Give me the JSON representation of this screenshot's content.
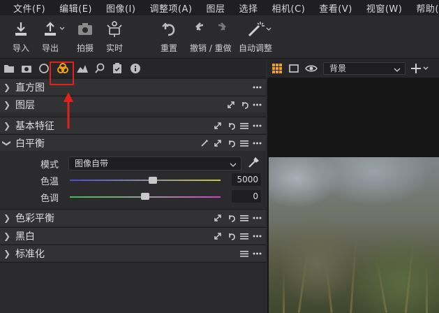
{
  "menu": {
    "items": [
      "文件(F)",
      "编辑(E)",
      "图像(I)",
      "调整项(A)",
      "图层",
      "选择",
      "相机(C)",
      "查看(V)",
      "视窗(W)",
      "帮助(H)"
    ]
  },
  "toolbar": {
    "import": "导入",
    "export": "导出",
    "capture": "拍摄",
    "live": "实时",
    "reset": "重置",
    "undo_redo": "撤销 / 重做",
    "auto_adjust": "自动调整"
  },
  "panel_tabs": [
    "library-icon",
    "camera-icon",
    "lens-icon",
    "color-icon",
    "exposure-icon",
    "details-icon",
    "adjustments-icon",
    "metadata-icon"
  ],
  "sections": {
    "histogram": "直方图",
    "layers": "图层",
    "basic": "基本特征",
    "white_balance": "白平衡",
    "color_balance": "色彩平衡",
    "black_white": "黑白",
    "normalize": "标准化"
  },
  "white_balance": {
    "mode_label": "模式",
    "mode_value": "图像自带",
    "kelvin_label": "色温",
    "kelvin_value": "5000",
    "kelvin_level": 0.55,
    "tint_label": "色调",
    "tint_value": "0",
    "tint_level": 0.5
  },
  "viewer": {
    "background_select": "背景"
  },
  "colors": {
    "highlight": "#e2221a",
    "accent_orange": "#f0a020"
  }
}
